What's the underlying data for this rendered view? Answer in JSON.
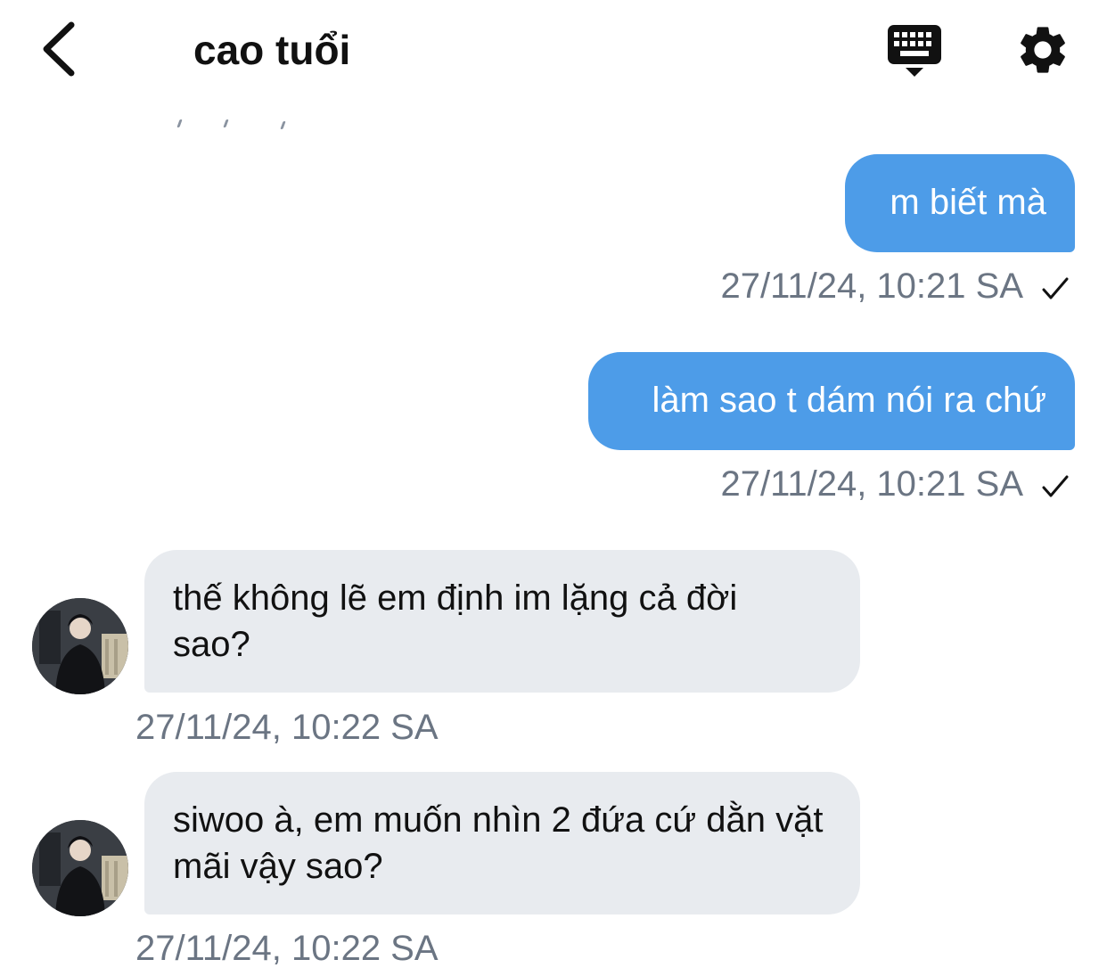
{
  "header": {
    "title": "cao tuổi",
    "back_icon": "chevron-left-icon",
    "keyboard_icon": "keyboard-hide-icon",
    "settings_icon": "gear-icon"
  },
  "messages": [
    {
      "direction": "out",
      "text": "m biết mà",
      "timestamp": "27/11/24, 10:21 SA",
      "status_icon": "check-icon"
    },
    {
      "direction": "out",
      "text": "làm sao t dám nói ra chứ",
      "timestamp": "27/11/24, 10:21 SA",
      "status_icon": "check-icon"
    },
    {
      "direction": "in",
      "text": "thế không lẽ em định im lặng cả đời sao?",
      "timestamp": "27/11/24, 10:22 SA"
    },
    {
      "direction": "in",
      "text": "siwoo à, em muốn nhìn 2 đứa cứ dằn vặt mãi vậy sao?",
      "timestamp": "27/11/24, 10:22 SA"
    }
  ],
  "colors": {
    "outgoing_bubble": "#4d9ce8",
    "incoming_bubble": "#e8ebef",
    "timestamp": "#6b7583",
    "title": "#111111"
  }
}
